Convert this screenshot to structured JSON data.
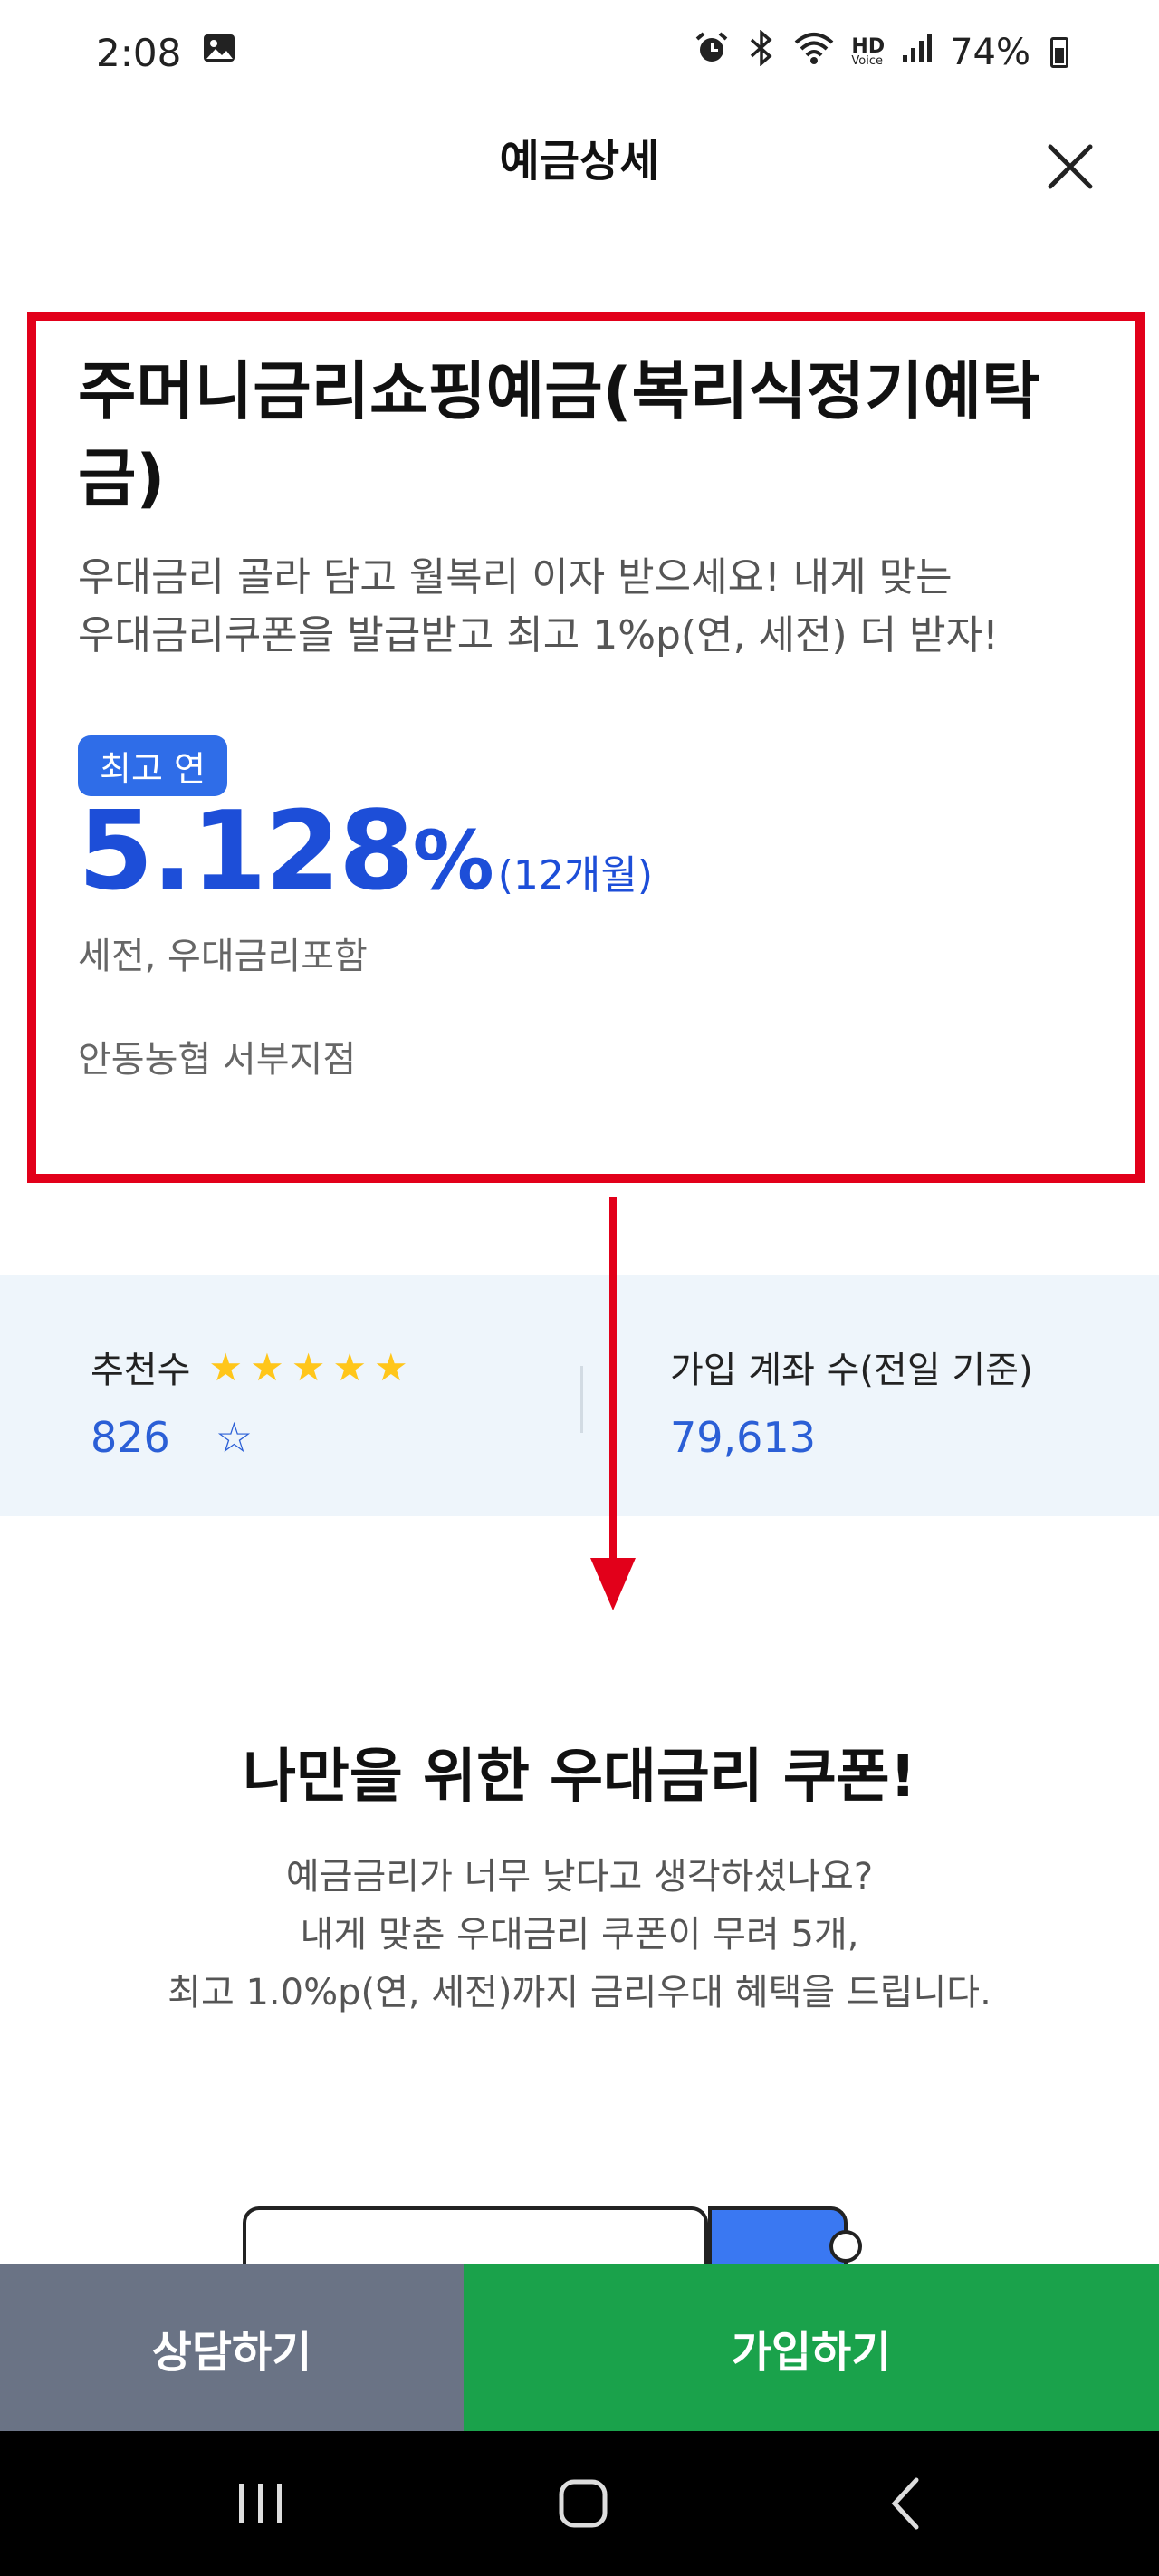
{
  "status_bar": {
    "time": "2:08",
    "battery": "74%",
    "icons": [
      "image-icon",
      "alarm-icon",
      "bluetooth-icon",
      "wifi-icon",
      "hd-voice-icon",
      "signal-icon",
      "battery-icon"
    ],
    "hd_label": "HD",
    "voice_label": "Voice"
  },
  "header": {
    "title": "예금상세",
    "close_icon": "close-icon"
  },
  "product": {
    "title": "주머니금리쇼핑예금(복리식정기예탁금)",
    "description_line1": "우대금리 골라 담고 월복리 이자 받으세요! 내게 맞는",
    "description_line2": "우대금리쿠폰을 발급받고 최고 1%p(연, 세전) 더 받자!",
    "rate_badge": "최고 연",
    "rate_value": "5.128",
    "rate_unit": "%",
    "rate_term": "(12개월)",
    "rate_note": "세전, 우대금리포함",
    "branch": "안동농협 서부지점"
  },
  "stats": {
    "recommend_label": "추천수",
    "recommend_count": "826",
    "rating_stars": 5,
    "accounts_label": "가입 계좌 수(전일 기준)",
    "accounts_count": "79,613"
  },
  "promo": {
    "title": "나만을 위한 우대금리 쿠폰!",
    "line1": "예금금리가 너무 낮다고 생각하셨나요?",
    "line2": "내게 맞춘 우대금리 쿠폰이 무려 5개,",
    "line3": "최고 1.0%p(연, 세전)까지 금리우대 혜택을 드립니다."
  },
  "buttons": {
    "consult": "상담하기",
    "join": "가입하기"
  },
  "colors": {
    "highlight_border": "#e2001a",
    "accent_blue": "#1d4ed8",
    "join_green": "#1aa24b",
    "consult_gray": "#6a7385",
    "star_yellow": "#ffc61a"
  }
}
